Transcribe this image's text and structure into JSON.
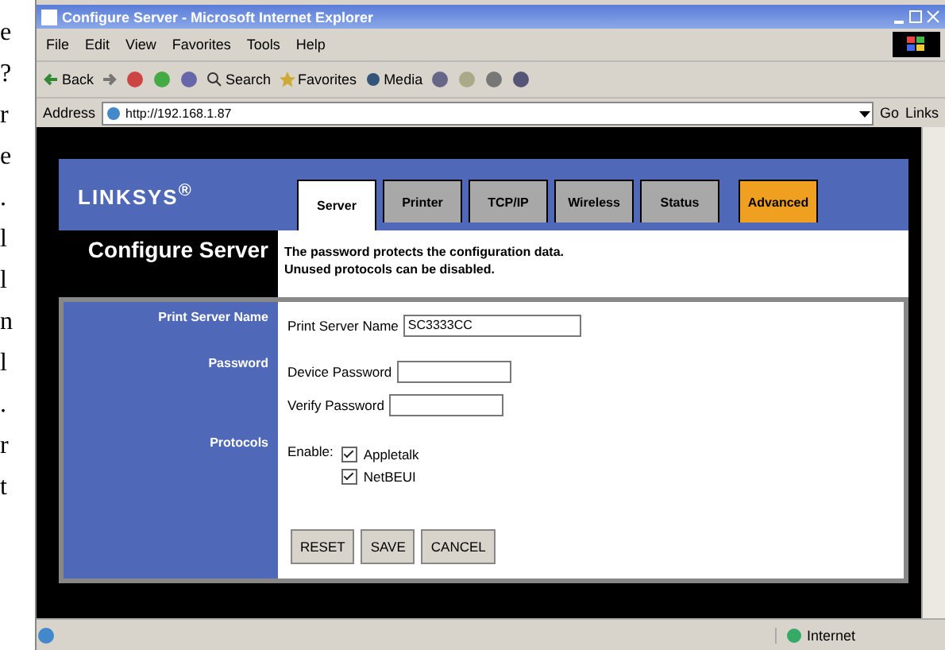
{
  "margin_text": [
    "e",
    "?",
    "r",
    "e",
    ".",
    "l",
    "l",
    "n",
    "l",
    ".",
    "r",
    "t"
  ],
  "window": {
    "title": "Configure Server - Microsoft Internet Explorer"
  },
  "menu": [
    "File",
    "Edit",
    "View",
    "Favorites",
    "Tools",
    "Help"
  ],
  "toolbar": {
    "back": "Back",
    "search": "Search",
    "favorites": "Favorites",
    "media": "Media"
  },
  "address": {
    "label": "Address",
    "value": "http://192.168.1.87",
    "go": "Go",
    "links": "Links"
  },
  "logo": "LINKSYS$^{®}$",
  "tabs": [
    {
      "label": "Server",
      "selected": true,
      "kind": "normal"
    },
    {
      "label": "Printer",
      "selected": false,
      "kind": "normal"
    },
    {
      "label": "TCP/IP",
      "selected": false,
      "kind": "normal"
    },
    {
      "label": "Wireless",
      "selected": false,
      "kind": "normal"
    },
    {
      "label": "Status",
      "selected": false,
      "kind": "normal"
    },
    {
      "label": "Advanced",
      "selected": false,
      "kind": "highlight"
    }
  ],
  "page_title": "Configure Server",
  "description": [
    "The password protects the configuration data.",
    "Unused protocols can be disabled."
  ],
  "sections": [
    {
      "label": "Print Server Name",
      "fields": [
        {
          "label": "Print Server Name",
          "value": "SC3333CC",
          "kind": "wide"
        }
      ]
    },
    {
      "label": "Password",
      "fields": [
        {
          "label": "Device Password",
          "kind": "short"
        },
        {
          "label": "Verify Password",
          "kind": "short"
        }
      ]
    },
    {
      "label": "Protocols",
      "enable": "Enable:",
      "options": [
        {
          "label": "Appletalk",
          "checked": true
        },
        {
          "label": "NetBEUI",
          "checked": true
        }
      ]
    }
  ],
  "buttons": [
    "RESET",
    "SAVE",
    "CANCEL"
  ],
  "status_bar": {
    "zone": "Internet"
  }
}
